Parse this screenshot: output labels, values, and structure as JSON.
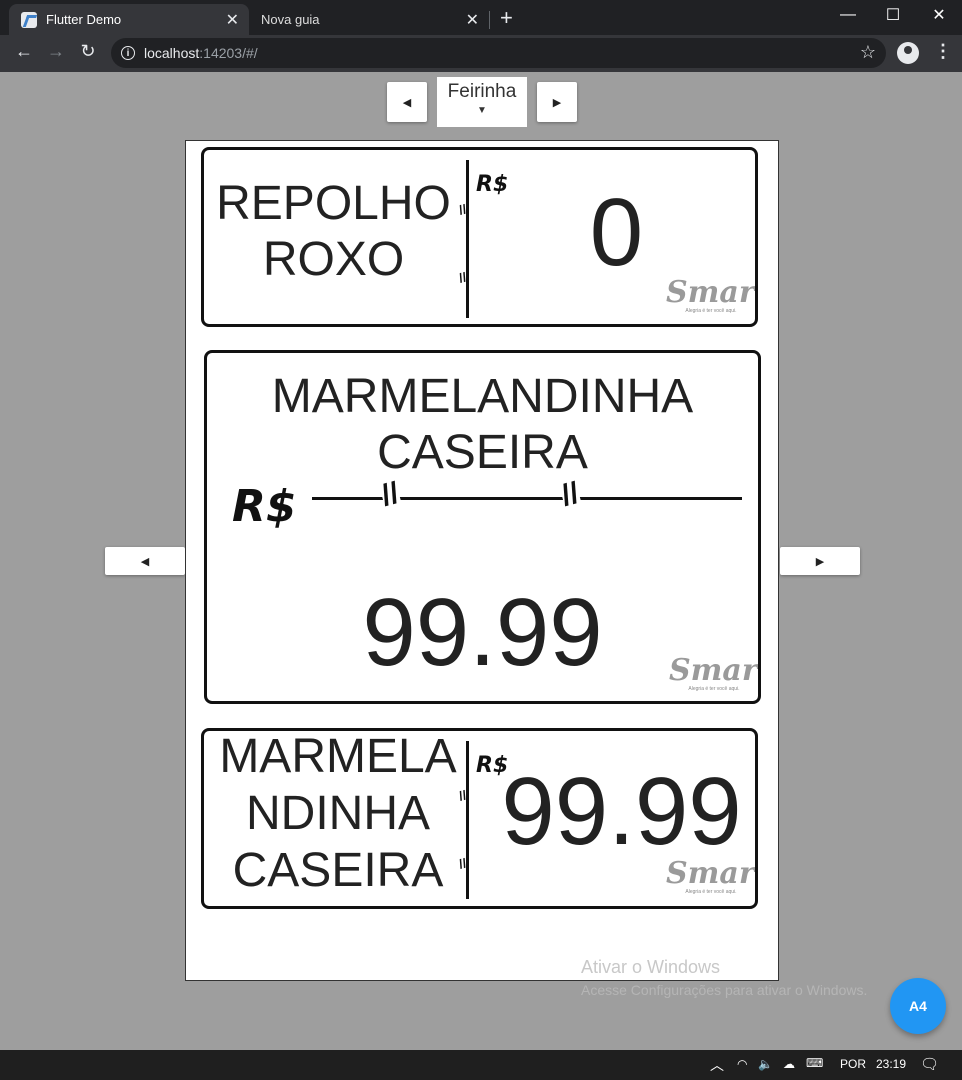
{
  "browser": {
    "tabs": [
      {
        "title": "Flutter Demo",
        "active": true
      },
      {
        "title": "Nova guia",
        "active": false
      }
    ],
    "url_host": "localhost",
    "url_rest": ":14203/#/"
  },
  "app": {
    "dropdown_value": "Feirinha",
    "fab_label": "A4"
  },
  "labels": [
    {
      "name_line1": "REPOLHO",
      "name_line2": "ROXO",
      "currency": "R$",
      "price": "0",
      "brand": "Smart",
      "tagline": "Alegria é ter você aqui."
    },
    {
      "name_line1": "MARMELANDINHA",
      "name_line2": "CASEIRA",
      "currency": "R$",
      "price": "99.99",
      "brand": "Smart",
      "tagline": "Alegria é ter você aqui."
    },
    {
      "name_line1": "MARMELA",
      "name_line2": "NDINHA",
      "name_line3": "CASEIRA",
      "currency": "R$",
      "price": "99.99",
      "brand": "Smart",
      "tagline": "Alegria é ter você aqui."
    }
  ],
  "watermark": {
    "line1": "Ativar o Windows",
    "line2": "Acesse Configurações para ativar o Windows."
  },
  "taskbar": {
    "language": "POR",
    "time": "23:19"
  },
  "colors": {
    "accent": "#2196f3",
    "page_bg": "#9e9e9e"
  }
}
